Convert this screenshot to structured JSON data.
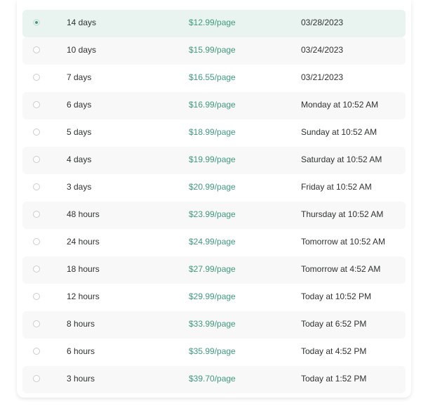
{
  "options": [
    {
      "deadline": "14 days",
      "price": "$12.99/page",
      "due": "03/28/2023",
      "selected": true
    },
    {
      "deadline": "10 days",
      "price": "$15.99/page",
      "due": "03/24/2023",
      "selected": false
    },
    {
      "deadline": "7 days",
      "price": "$16.55/page",
      "due": "03/21/2023",
      "selected": false
    },
    {
      "deadline": "6 days",
      "price": "$16.99/page",
      "due": "Monday at 10:52 AM",
      "selected": false
    },
    {
      "deadline": "5 days",
      "price": "$18.99/page",
      "due": "Sunday at 10:52 AM",
      "selected": false
    },
    {
      "deadline": "4 days",
      "price": "$19.99/page",
      "due": "Saturday at 10:52 AM",
      "selected": false
    },
    {
      "deadline": "3 days",
      "price": "$20.99/page",
      "due": "Friday at 10:52 AM",
      "selected": false
    },
    {
      "deadline": "48 hours",
      "price": "$23.99/page",
      "due": "Thursday at 10:52 AM",
      "selected": false
    },
    {
      "deadline": "24 hours",
      "price": "$24.99/page",
      "due": "Tomorrow at 10:52 AM",
      "selected": false
    },
    {
      "deadline": "18 hours",
      "price": "$27.99/page",
      "due": "Tomorrow at 4:52 AM",
      "selected": false
    },
    {
      "deadline": "12 hours",
      "price": "$29.99/page",
      "due": "Today at 10:52 PM",
      "selected": false
    },
    {
      "deadline": "8 hours",
      "price": "$33.99/page",
      "due": "Today at 6:52 PM",
      "selected": false
    },
    {
      "deadline": "6 hours",
      "price": "$35.99/page",
      "due": "Today at 4:52 PM",
      "selected": false
    },
    {
      "deadline": "3 hours",
      "price": "$39.70/page",
      "due": "Today at 1:52 PM",
      "selected": false
    }
  ],
  "colors": {
    "accent": "#3f9b7a",
    "selected_row_bg": "#e9f3ef",
    "alt_row_bg": "#f7f8f7",
    "text": "#2f3333"
  }
}
